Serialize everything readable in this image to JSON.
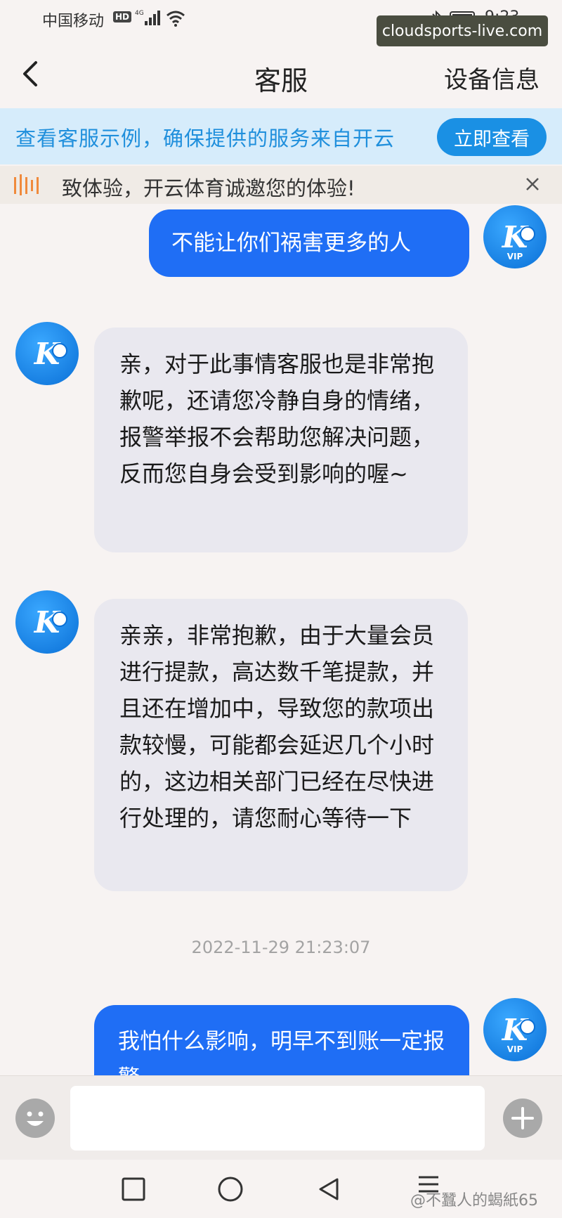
{
  "status_bar": {
    "carrier": "中国移动",
    "hd_label": "HD",
    "network_label": "4G",
    "time": "9:23"
  },
  "watermark_top": "cloudsports-live.com",
  "nav": {
    "title": "客服",
    "right_label": "设备信息"
  },
  "banner": {
    "text": "查看客服示例，确保提供的服务来自开云",
    "button_label": "立即查看"
  },
  "notice": {
    "text": "致体验，开云体育诚邀您的体验!"
  },
  "messages": [
    {
      "side": "out",
      "text": "不能让你们祸害更多的人"
    },
    {
      "side": "in",
      "text": "亲，对于此事情客服也是非常抱歉呢，还请您冷静自身的情绪，报警举报不会帮助您解决问题，反而您自身会受到影响的喔~"
    },
    {
      "side": "in",
      "text": "亲亲，非常抱歉，由于大量会员进行提款，高达数千笔提款，并且还在增加中，导致您的款项出款较慢，可能都会延迟几个小时的，这边相关部门已经在尽快进行处理的，请您耐心等待一下"
    },
    {
      "side": "out",
      "text": "我怕什么影响，明早不到账一定报警"
    }
  ],
  "avatar": {
    "letter": "K",
    "vip_label": "VIP"
  },
  "timestamp": "2022-11-29 21:23:07",
  "input": {
    "placeholder": ""
  },
  "watermark_bottom": "@不蠶人的蝎紙65",
  "colors": {
    "accent_blue": "#1f6ef5",
    "banner_bg": "#d6ecfb",
    "banner_text": "#1f8fdc",
    "incoming_bubble": "#e9e8ef"
  }
}
